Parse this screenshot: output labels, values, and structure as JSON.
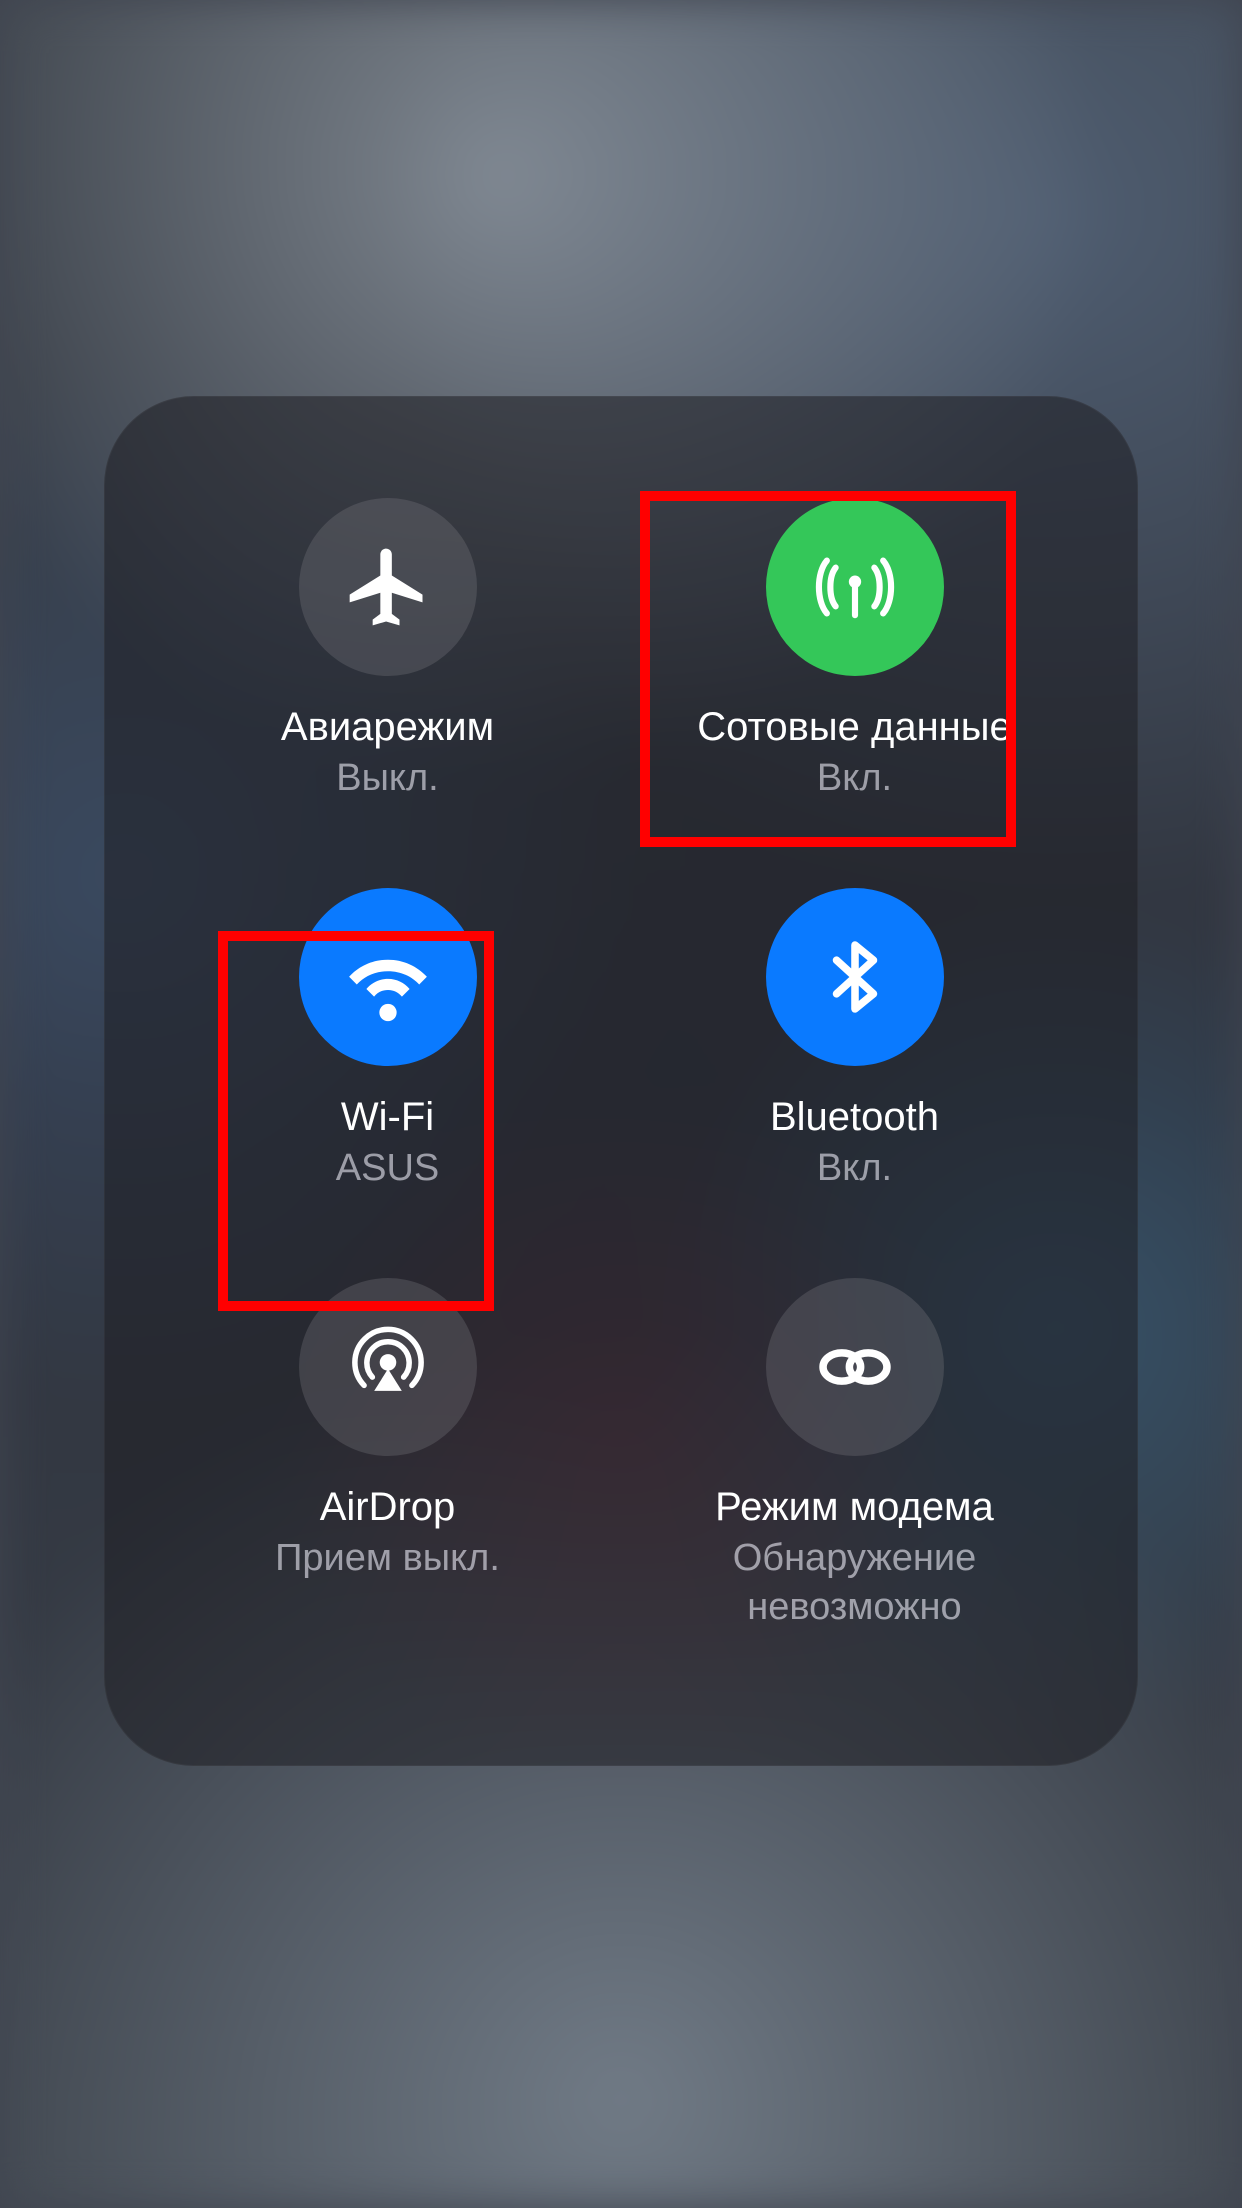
{
  "controls": {
    "airplane": {
      "label": "Авиарежим",
      "status": "Выкл."
    },
    "cellular": {
      "label": "Сотовые данные",
      "status": "Вкл."
    },
    "wifi": {
      "label": "Wi-Fi",
      "status": "ASUS"
    },
    "bluetooth": {
      "label": "Bluetooth",
      "status": "Вкл."
    },
    "airdrop": {
      "label": "AirDrop",
      "status": "Прием выкл."
    },
    "hotspot": {
      "label": "Режим модема",
      "status": "Обнаружение невозможно"
    }
  },
  "colors": {
    "green": "#34C759",
    "blue": "#0A7AFF",
    "highlight": "#FF0000"
  }
}
